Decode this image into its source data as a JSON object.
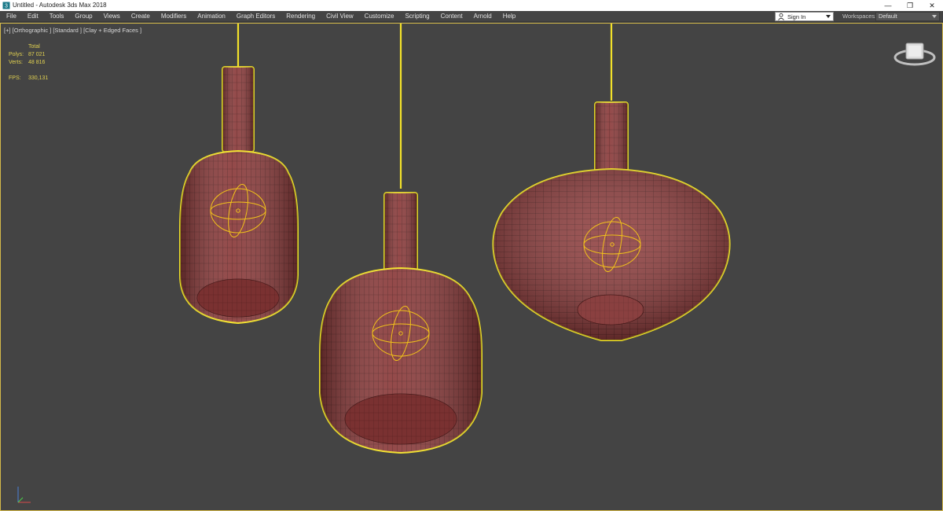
{
  "window": {
    "title": "Untitled - Autodesk 3ds Max 2018",
    "controls": {
      "minimize": "—",
      "restore": "❐",
      "close": "✕"
    }
  },
  "menu": {
    "items": [
      "File",
      "Edit",
      "Tools",
      "Group",
      "Views",
      "Create",
      "Modifiers",
      "Animation",
      "Graph Editors",
      "Rendering",
      "Civil View",
      "Customize",
      "Scripting",
      "Content",
      "Arnold",
      "Help"
    ]
  },
  "account": {
    "sign_in_label": "Sign In"
  },
  "workspaces": {
    "label": "Workspaces:",
    "value": "Default"
  },
  "viewport": {
    "label": "[+] [Orthographic ] [Standard ] [Clay + Edged Faces ]",
    "stats": {
      "header": "Total",
      "polys_label": "Polys:",
      "polys_value": "87 021",
      "verts_label": "Verts:",
      "verts_value": "48 816",
      "fps_label": "FPS:",
      "fps_value": "330,131"
    }
  },
  "colors": {
    "viewport_bg": "#444444",
    "selection": "#f2e12a",
    "mesh": "#8a3a3a",
    "mesh_edge": "#3a1414",
    "stats_text": "#e0d050"
  },
  "icons": {
    "app": "3dsmax-app-icon",
    "user": "user-icon",
    "viewcube": "viewcube-icon",
    "axis": "axis-tripod-icon"
  }
}
